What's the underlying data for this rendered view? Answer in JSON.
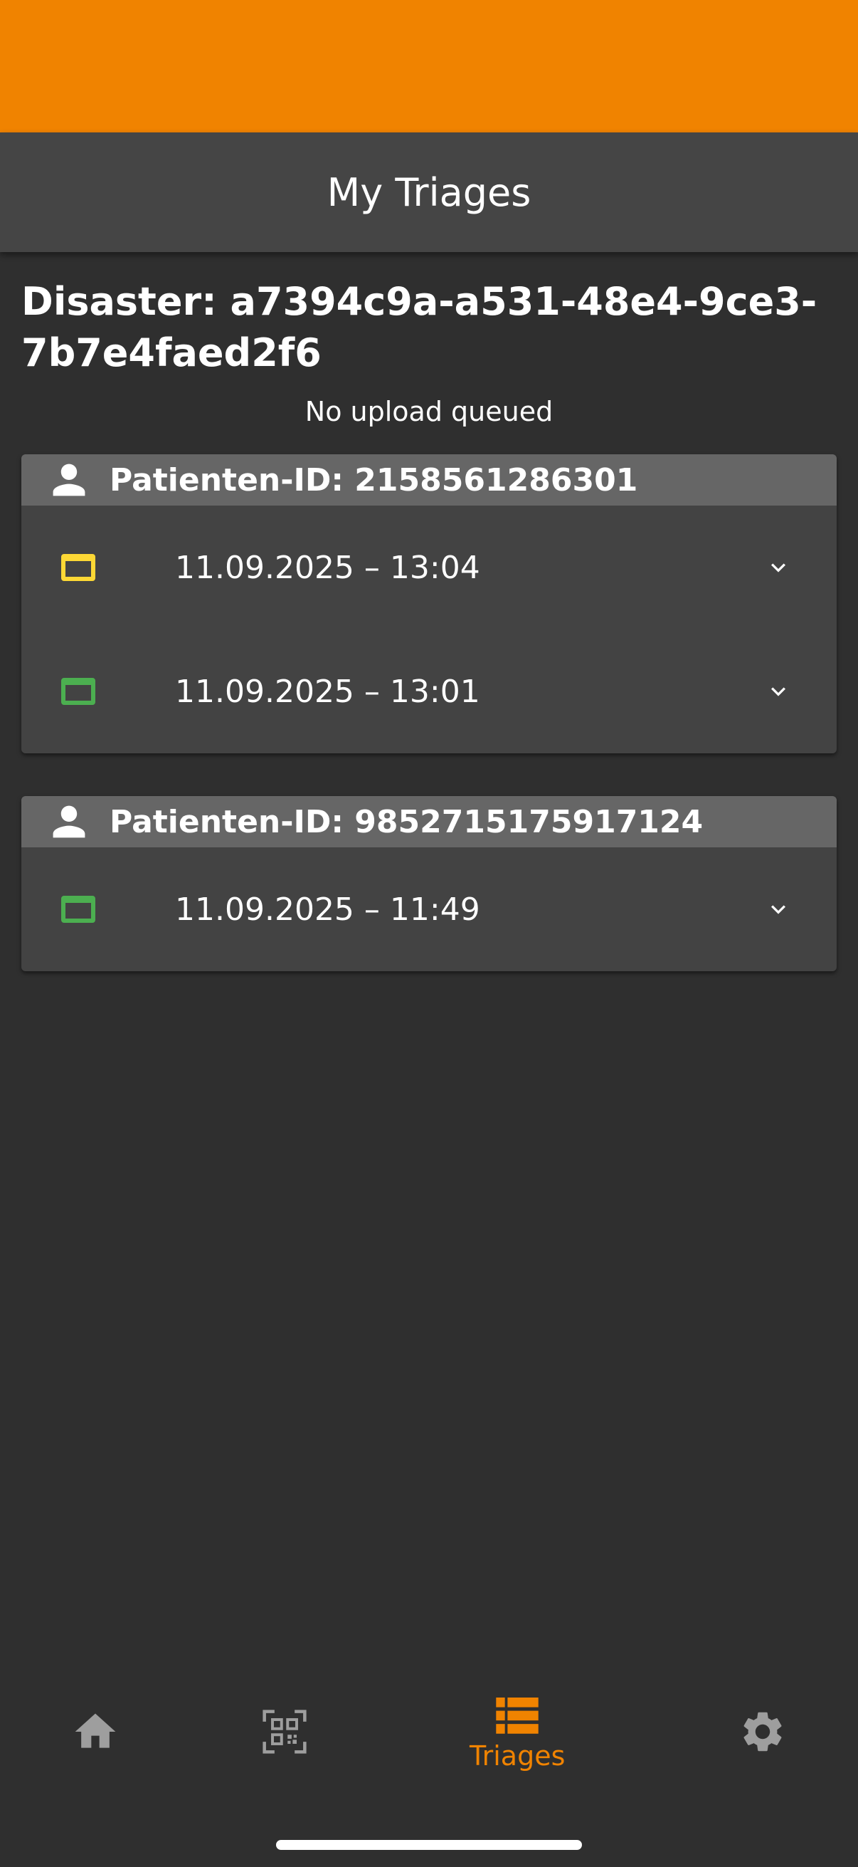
{
  "app_bar": {
    "title": "My Triages"
  },
  "disaster": {
    "title": "Disaster: a7394c9a-a531-48e4-9ce3-7b7e4faed2f6"
  },
  "upload_status": "No upload queued",
  "patients": [
    {
      "id_label": "Patienten-ID: 2158561286301",
      "triages": [
        {
          "date": "11.09.2025 – 13:04",
          "category_color": "#fdd835"
        },
        {
          "date": "11.09.2025 – 13:01",
          "category_color": "#4caf50"
        }
      ]
    },
    {
      "id_label": "Patienten-ID: 9852715175917124",
      "triages": [
        {
          "date": "11.09.2025 – 11:49",
          "category_color": "#4caf50"
        }
      ]
    }
  ],
  "bottom_nav": {
    "items": [
      {
        "icon": "home-icon",
        "label": ""
      },
      {
        "icon": "qr-code-icon",
        "label": ""
      },
      {
        "icon": "list-icon",
        "label": "Triages",
        "active": true
      },
      {
        "icon": "gear-icon",
        "label": ""
      }
    ]
  },
  "colors": {
    "accent": "#f08300",
    "background": "#2f2f2f",
    "app_bar": "#454545",
    "card": "#434343",
    "card_header": "#666666",
    "inactive_icon": "#9e9e9e"
  }
}
